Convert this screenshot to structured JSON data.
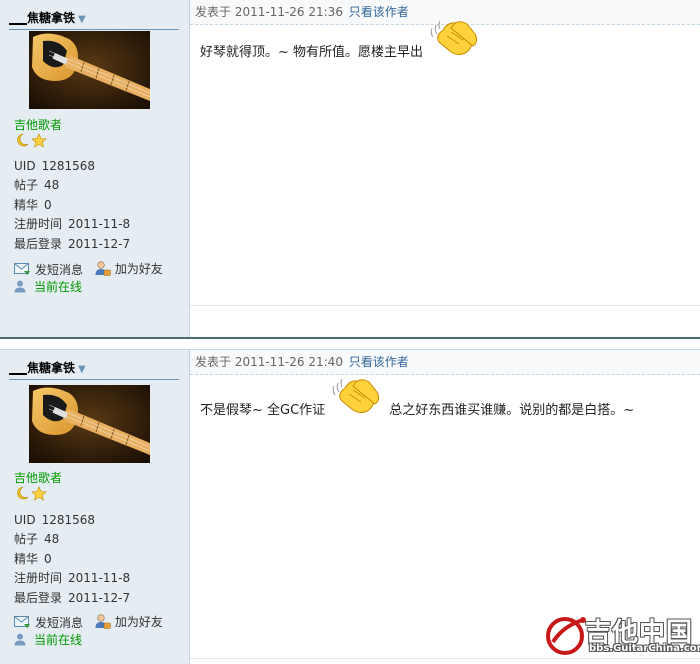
{
  "posts": [
    {
      "author": {
        "name_prefix": "___",
        "name": "焦糖拿铁",
        "group": "吉他歌者",
        "stats": [
          {
            "label": "UID",
            "value": "1281568"
          },
          {
            "label": "帖子",
            "value": "48"
          },
          {
            "label": "精华",
            "value": "0"
          },
          {
            "label": "注册时间",
            "value": "2011-11-8"
          },
          {
            "label": "最后登录",
            "value": "2011-12-7"
          }
        ],
        "actions": {
          "message": "发短消息",
          "add_friend": "加为好友",
          "online": "当前在线"
        }
      },
      "meta": {
        "posted": "发表于 2011-11-26 21:36",
        "author_only": "只看该作者"
      },
      "content": {
        "before": "好琴就得顶。~ 物有所值。愿楼主早出",
        "after": ""
      }
    },
    {
      "author": {
        "name_prefix": "___",
        "name": "焦糖拿铁",
        "group": "吉他歌者",
        "stats": [
          {
            "label": "UID",
            "value": "1281568"
          },
          {
            "label": "帖子",
            "value": "48"
          },
          {
            "label": "精华",
            "value": "0"
          },
          {
            "label": "注册时间",
            "value": "2011-11-8"
          },
          {
            "label": "最后登录",
            "value": "2011-12-7"
          }
        ],
        "actions": {
          "message": "发短消息",
          "add_friend": "加为好友",
          "online": "当前在线"
        }
      },
      "meta": {
        "posted": "发表于 2011-11-26 21:40",
        "author_only": "只看该作者"
      },
      "content": {
        "before": "不是假琴~ 全GC作证",
        "after": "总之好东西谁买谁赚。说别的都是白搭。~"
      }
    }
  ],
  "watermark": {
    "main": "吉他中国",
    "sub": "bbs.GuitarChina.com"
  },
  "colors": {
    "sidebar_bg": "#e5edf2",
    "group": "#009900",
    "link": "#336699",
    "separator": "#4d6d6d"
  },
  "icons": [
    "dropdown-triangle-icon",
    "moon-icon",
    "star-icon",
    "message-icon",
    "add-friend-icon",
    "user-online-icon",
    "clapping-hands-icon",
    "guitarchina-logo"
  ]
}
